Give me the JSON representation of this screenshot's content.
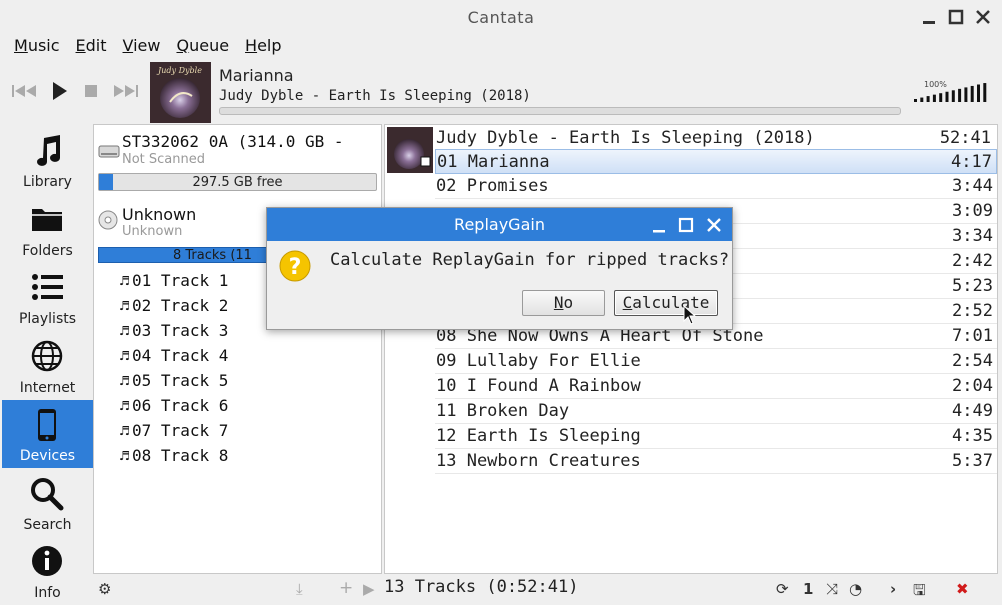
{
  "window": {
    "title": "Cantata"
  },
  "menu": [
    {
      "label": "Music",
      "mnemonic": "M",
      "rest": "usic"
    },
    {
      "label": "Edit",
      "mnemonic": "E",
      "rest": "dit"
    },
    {
      "label": "View",
      "mnemonic": "V",
      "rest": "iew"
    },
    {
      "label": "Queue",
      "mnemonic": "Q",
      "rest": "ueue"
    },
    {
      "label": "Help",
      "mnemonic": "H",
      "rest": "elp"
    }
  ],
  "now_playing": {
    "title": "Marianna",
    "artist_album": "Judy Dyble - Earth Is Sleeping (2018)",
    "progress_fraction": 0.0,
    "volume_label": "100%",
    "volume_fraction": 1.0,
    "cover_text": "Judy Dyble"
  },
  "sidebar": {
    "items": [
      {
        "label": "Library",
        "icon": "music-note-icon"
      },
      {
        "label": "Folders",
        "icon": "folder-icon"
      },
      {
        "label": "Playlists",
        "icon": "list-icon"
      },
      {
        "label": "Internet",
        "icon": "globe-icon"
      },
      {
        "label": "Devices",
        "icon": "phone-icon",
        "active": true
      },
      {
        "label": "Search",
        "icon": "search-icon"
      },
      {
        "label": "Info",
        "icon": "info-icon"
      }
    ]
  },
  "devices": {
    "drive": {
      "name": "ST332062 0A (314.0 GB -",
      "status": "Not Scanned",
      "free_text": "297.5 GB free",
      "used_fraction": 0.05
    },
    "cd": {
      "name": "Unknown",
      "sub": "Unknown",
      "tracks_text": "8 Tracks (11"
    },
    "tracks": [
      "01 Track 1",
      "02 Track 2",
      "03 Track 3",
      "04 Track 4",
      "05 Track 5",
      "06 Track 6",
      "07 Track 7",
      "08 Track 8"
    ]
  },
  "queue": {
    "album": "Judy Dyble - Earth Is Sleeping (2018)",
    "total": "52:41",
    "rows": [
      {
        "title": "01 Marianna",
        "duration": "4:17",
        "selected": true
      },
      {
        "title": "02 Promises",
        "duration": "3:44"
      },
      {
        "title": "",
        "duration": "3:09"
      },
      {
        "title": "",
        "duration": "3:34"
      },
      {
        "title": "",
        "duration": "2:42"
      },
      {
        "title": "",
        "duration": "5:23"
      },
      {
        "title": "",
        "duration": "2:52"
      },
      {
        "title": "08 She Now Owns A Heart Of Stone",
        "duration": "7:01"
      },
      {
        "title": "09 Lullaby For Ellie",
        "duration": "2:54"
      },
      {
        "title": "10 I Found A Rainbow",
        "duration": "2:04"
      },
      {
        "title": "11 Broken Day",
        "duration": "4:49"
      },
      {
        "title": "12 Earth Is Sleeping",
        "duration": "4:35"
      },
      {
        "title": "13 Newborn Creatures",
        "duration": "5:37"
      }
    ]
  },
  "status": {
    "text": "13 Tracks (0:52:41)",
    "single_label": "1"
  },
  "dialog": {
    "title": "ReplayGain",
    "message": "Calculate ReplayGain for ripped tracks?",
    "no_label": "No",
    "no_mnemonic": "N",
    "no_rest": "o",
    "calc_label": "Calculate",
    "calc_mnemonic": "C",
    "calc_rest": "alculate"
  },
  "colors": {
    "accent": "#2f7ed8",
    "warning": "#f5c400",
    "stop": "#d11b1b"
  }
}
